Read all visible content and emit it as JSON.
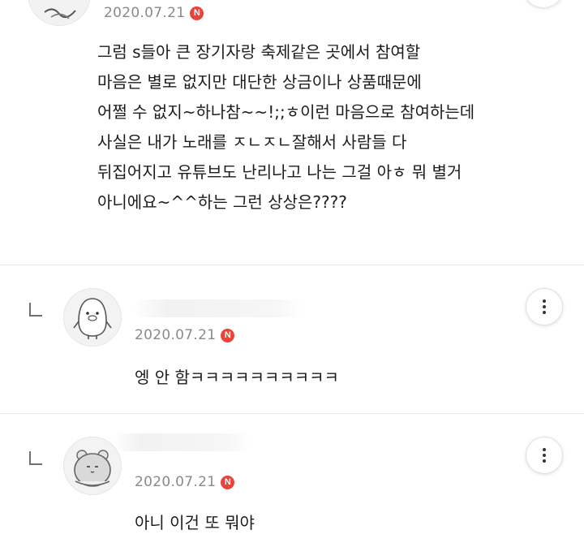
{
  "top_comment": {
    "date": "2020.07.21",
    "badge": "N",
    "lines": [
      "그럼 s들아 큰 장기자랑 축제같은 곳에서 참여할",
      "마음은 별로 없지만 대단한 상금이나 상품때문에",
      "어쩔 수 없지~하나참~~!;;ㅎ이런 마음으로 참여하는데",
      "사실은 내가 노래를 ㅈㄴㅈㄴ잘해서 사람들 다",
      "뒤집어지고 유튜브도 난리나고 나는 그걸 아ㅎ 뭐 별거",
      "아니에요~^^하는 그런 상상은????"
    ]
  },
  "replies": [
    {
      "date": "2020.07.21",
      "badge": "N",
      "text": "엥 안 함ㅋㅋㅋㅋㅋㅋㅋㅋㅋㅋ"
    },
    {
      "date": "2020.07.21",
      "badge": "N",
      "text": "아니 이건 또 뭐야"
    }
  ],
  "icons": {
    "reply_arrow": "reply-arrow-icon",
    "more": "more-vertical-icon",
    "badge": "new-badge-icon"
  },
  "colors": {
    "badge": "#e8443a",
    "date": "#8a8a8a",
    "divider": "#e8e8e8"
  }
}
